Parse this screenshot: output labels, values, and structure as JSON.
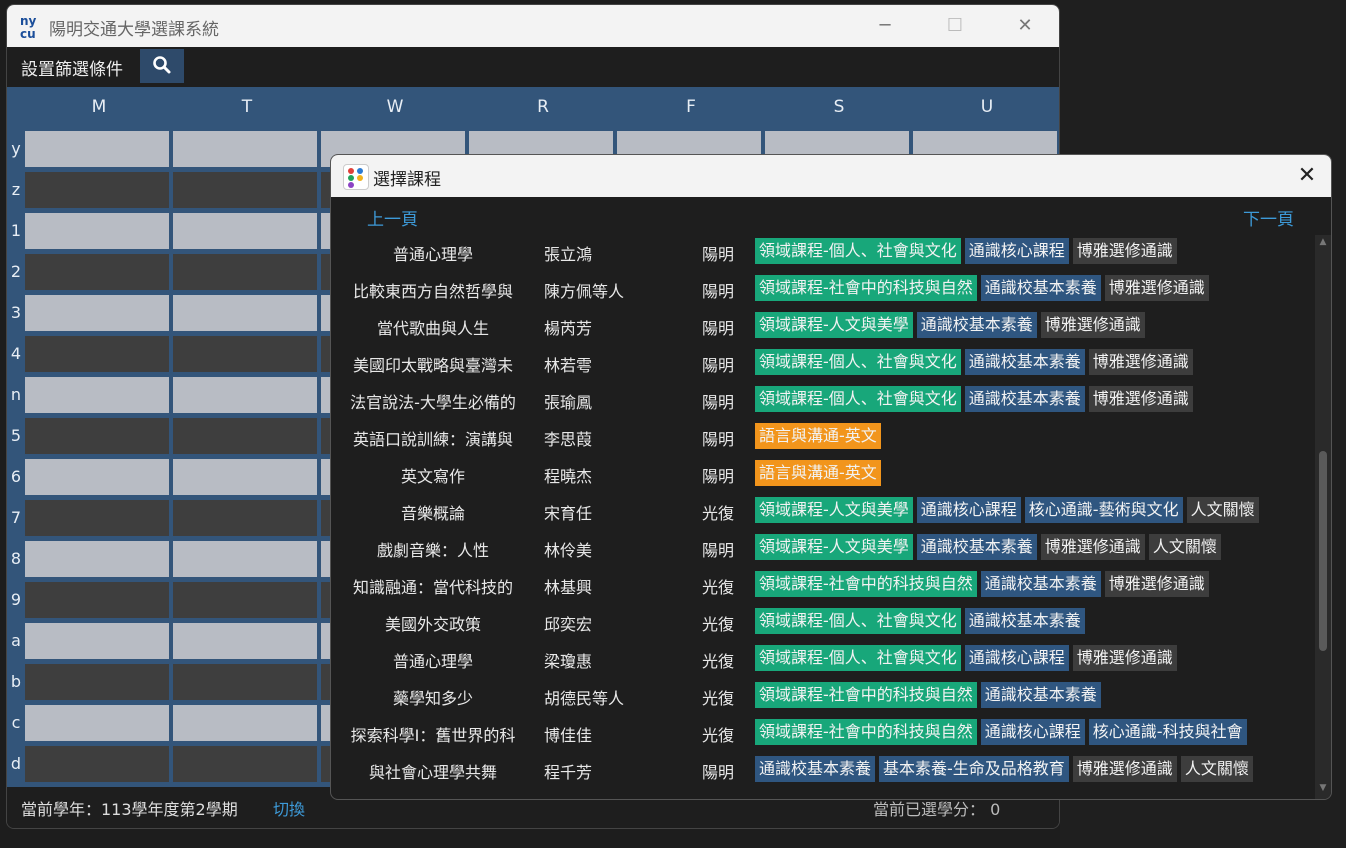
{
  "window": {
    "title": "陽明交通大學選課系統",
    "minimize": "─",
    "maximize": "☐",
    "close": "✕"
  },
  "toolbar": {
    "filter_label": "設置篩選條件",
    "search_icon": "search-icon"
  },
  "schedule": {
    "days": [
      "M",
      "T",
      "W",
      "R",
      "F",
      "S",
      "U"
    ],
    "periods": [
      "y",
      "z",
      "1",
      "2",
      "3",
      "4",
      "n",
      "5",
      "6",
      "7",
      "8",
      "9",
      "a",
      "b",
      "c",
      "d"
    ]
  },
  "status": {
    "term": "當前學年：113學年度第2學期",
    "switch": "切換",
    "credits": "當前已選學分：  0"
  },
  "dialog": {
    "title": "選擇課程",
    "close": "✕",
    "prev": "上一頁",
    "next": "下一頁",
    "courses": [
      {
        "name": "普通心理學",
        "teacher": "張立鴻",
        "campus": "陽明",
        "tags": [
          {
            "text": "領域課程-個人、社會與文化",
            "kind": "green"
          },
          {
            "text": "通識核心課程",
            "kind": "blue"
          },
          {
            "text": "博雅選修通識",
            "kind": "gray"
          }
        ]
      },
      {
        "name": "比較東西方自然哲學與",
        "teacher": "陳方佩等人",
        "campus": "陽明",
        "tags": [
          {
            "text": "領域課程-社會中的科技與自然",
            "kind": "green"
          },
          {
            "text": "通識校基本素養",
            "kind": "blue"
          },
          {
            "text": "博雅選修通識",
            "kind": "gray"
          }
        ]
      },
      {
        "name": "當代歌曲與人生",
        "teacher": "楊芮芳",
        "campus": "陽明",
        "tags": [
          {
            "text": "領域課程-人文與美學",
            "kind": "green"
          },
          {
            "text": "通識校基本素養",
            "kind": "blue"
          },
          {
            "text": "博雅選修通識",
            "kind": "gray"
          }
        ]
      },
      {
        "name": "美國印太戰略與臺灣未",
        "teacher": "林若雩",
        "campus": "陽明",
        "tags": [
          {
            "text": "領域課程-個人、社會與文化",
            "kind": "green"
          },
          {
            "text": "通識校基本素養",
            "kind": "blue"
          },
          {
            "text": "博雅選修通識",
            "kind": "gray"
          }
        ]
      },
      {
        "name": "法官說法-大學生必備的",
        "teacher": "張瑜鳳",
        "campus": "陽明",
        "tags": [
          {
            "text": "領域課程-個人、社會與文化",
            "kind": "green"
          },
          {
            "text": "通識校基本素養",
            "kind": "blue"
          },
          {
            "text": "博雅選修通識",
            "kind": "gray"
          }
        ]
      },
      {
        "name": "英語口說訓練：演講與",
        "teacher": "李思葭",
        "campus": "陽明",
        "tags": [
          {
            "text": "語言與溝通-英文",
            "kind": "orange"
          }
        ]
      },
      {
        "name": "英文寫作",
        "teacher": "程曉杰",
        "campus": "陽明",
        "tags": [
          {
            "text": "語言與溝通-英文",
            "kind": "orange"
          }
        ]
      },
      {
        "name": "音樂概論",
        "teacher": "宋育任",
        "campus": "光復",
        "tags": [
          {
            "text": "領域課程-人文與美學",
            "kind": "green"
          },
          {
            "text": "通識核心課程",
            "kind": "blue"
          },
          {
            "text": "核心通識-藝術與文化",
            "kind": "blue"
          },
          {
            "text": "人文關懷",
            "kind": "gray"
          }
        ]
      },
      {
        "name": "戲劇音樂：人性",
        "teacher": "林伶美",
        "campus": "陽明",
        "tags": [
          {
            "text": "領域課程-人文與美學",
            "kind": "green"
          },
          {
            "text": "通識校基本素養",
            "kind": "blue"
          },
          {
            "text": "博雅選修通識",
            "kind": "gray"
          },
          {
            "text": "人文關懷",
            "kind": "gray"
          }
        ]
      },
      {
        "name": "知識融通：當代科技的",
        "teacher": "林基興",
        "campus": "光復",
        "tags": [
          {
            "text": "領域課程-社會中的科技與自然",
            "kind": "green"
          },
          {
            "text": "通識校基本素養",
            "kind": "blue"
          },
          {
            "text": "博雅選修通識",
            "kind": "gray"
          }
        ]
      },
      {
        "name": "美國外交政策",
        "teacher": "邱奕宏",
        "campus": "光復",
        "tags": [
          {
            "text": "領域課程-個人、社會與文化",
            "kind": "green"
          },
          {
            "text": "通識校基本素養",
            "kind": "blue"
          }
        ]
      },
      {
        "name": "普通心理學",
        "teacher": "梁瓊惠",
        "campus": "光復",
        "tags": [
          {
            "text": "領域課程-個人、社會與文化",
            "kind": "green"
          },
          {
            "text": "通識核心課程",
            "kind": "blue"
          },
          {
            "text": "博雅選修通識",
            "kind": "gray"
          }
        ]
      },
      {
        "name": "藥學知多少",
        "teacher": "胡德民等人",
        "campus": "光復",
        "tags": [
          {
            "text": "領域課程-社會中的科技與自然",
            "kind": "green"
          },
          {
            "text": "通識校基本素養",
            "kind": "blue"
          }
        ]
      },
      {
        "name": "探索科學I：舊世界的科",
        "teacher": "博佳佳",
        "campus": "光復",
        "tags": [
          {
            "text": "領域課程-社會中的科技與自然",
            "kind": "green"
          },
          {
            "text": "通識核心課程",
            "kind": "blue"
          },
          {
            "text": "核心通識-科技與社會",
            "kind": "blue"
          }
        ]
      },
      {
        "name": "與社會心理學共舞",
        "teacher": "程千芳",
        "campus": "陽明",
        "tags": [
          {
            "text": "通識校基本素養",
            "kind": "blue"
          },
          {
            "text": "基本素養-生命及品格教育",
            "kind": "blue"
          },
          {
            "text": "博雅選修通識",
            "kind": "gray"
          },
          {
            "text": "人文關懷",
            "kind": "gray"
          }
        ]
      }
    ]
  },
  "colors": {
    "green": "#18a77a",
    "blue": "#2f5680",
    "gray": "#3d3d3d",
    "orange": "#f2951c",
    "link": "#3d9ad8"
  }
}
